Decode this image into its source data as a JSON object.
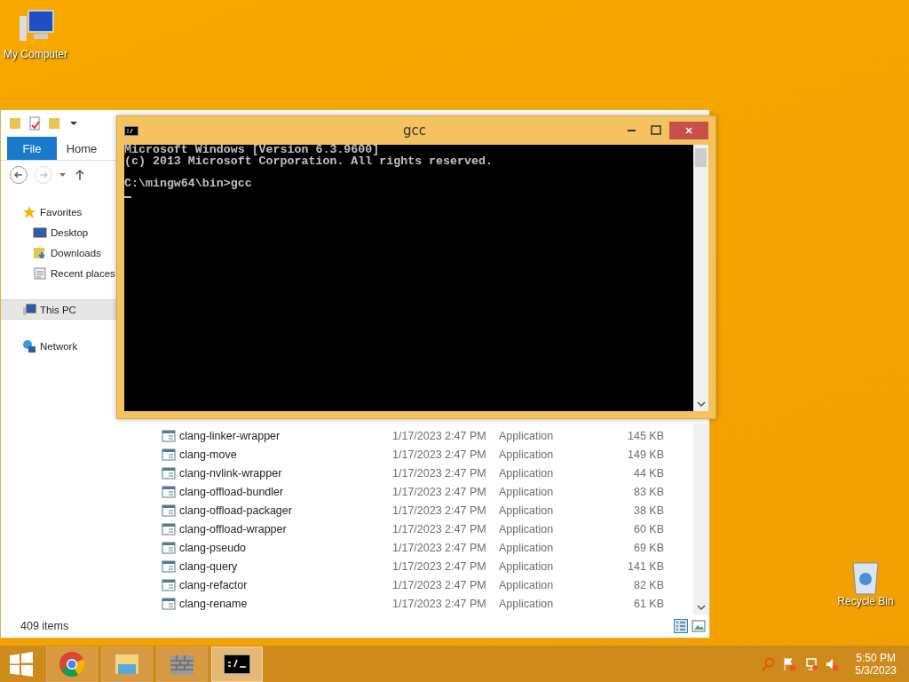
{
  "desktop_icons": [
    {
      "kind": "computer",
      "label": "My Computer"
    },
    {
      "kind": "recycle",
      "label": "Recycle Bin"
    }
  ],
  "explorer": {
    "tabs": [
      {
        "label": "File",
        "kind": "file"
      },
      {
        "label": "Home",
        "kind": "tab"
      }
    ],
    "sidebar": {
      "items": [
        {
          "kind": "favorites",
          "label": "Favorites",
          "selected": false,
          "children": [
            {
              "kind": "desktop",
              "label": "Desktop",
              "selected": false
            },
            {
              "kind": "downloads",
              "label": "Downloads",
              "selected": false
            },
            {
              "kind": "recent",
              "label": "Recent places",
              "selected": false
            }
          ]
        },
        {
          "kind": "pc",
          "label": "This PC",
          "selected": true
        },
        {
          "kind": "network",
          "label": "Network",
          "selected": false
        }
      ]
    },
    "files": [
      {
        "name": "clang-linker-wrapper",
        "date": "1/17/2023 2:47 PM",
        "type": "Application",
        "size": "145 KB"
      },
      {
        "name": "clang-move",
        "date": "1/17/2023 2:47 PM",
        "type": "Application",
        "size": "149 KB"
      },
      {
        "name": "clang-nvlink-wrapper",
        "date": "1/17/2023 2:47 PM",
        "type": "Application",
        "size": "44 KB"
      },
      {
        "name": "clang-offload-bundler",
        "date": "1/17/2023 2:47 PM",
        "type": "Application",
        "size": "83 KB"
      },
      {
        "name": "clang-offload-packager",
        "date": "1/17/2023 2:47 PM",
        "type": "Application",
        "size": "38 KB"
      },
      {
        "name": "clang-offload-wrapper",
        "date": "1/17/2023 2:47 PM",
        "type": "Application",
        "size": "60 KB"
      },
      {
        "name": "clang-pseudo",
        "date": "1/17/2023 2:47 PM",
        "type": "Application",
        "size": "69 KB"
      },
      {
        "name": "clang-query",
        "date": "1/17/2023 2:47 PM",
        "type": "Application",
        "size": "141 KB"
      },
      {
        "name": "clang-refactor",
        "date": "1/17/2023 2:47 PM",
        "type": "Application",
        "size": "82 KB"
      },
      {
        "name": "clang-rename",
        "date": "1/17/2023 2:47 PM",
        "type": "Application",
        "size": "61 KB"
      }
    ],
    "status": "409 items"
  },
  "console": {
    "title": "gcc",
    "lines": [
      "Microsoft Windows [Version 6.3.9600]",
      "(c) 2013 Microsoft Corporation. All rights reserved."
    ],
    "prompt": "C:\\mingw64\\bin>gcc"
  },
  "taskbar": {
    "apps": [
      {
        "kind": "chrome",
        "selected": false
      },
      {
        "kind": "explorer",
        "selected": false
      },
      {
        "kind": "firewall",
        "selected": false
      },
      {
        "kind": "console",
        "selected": true
      }
    ],
    "time": "5:50 PM",
    "date": "5/3/2023"
  }
}
